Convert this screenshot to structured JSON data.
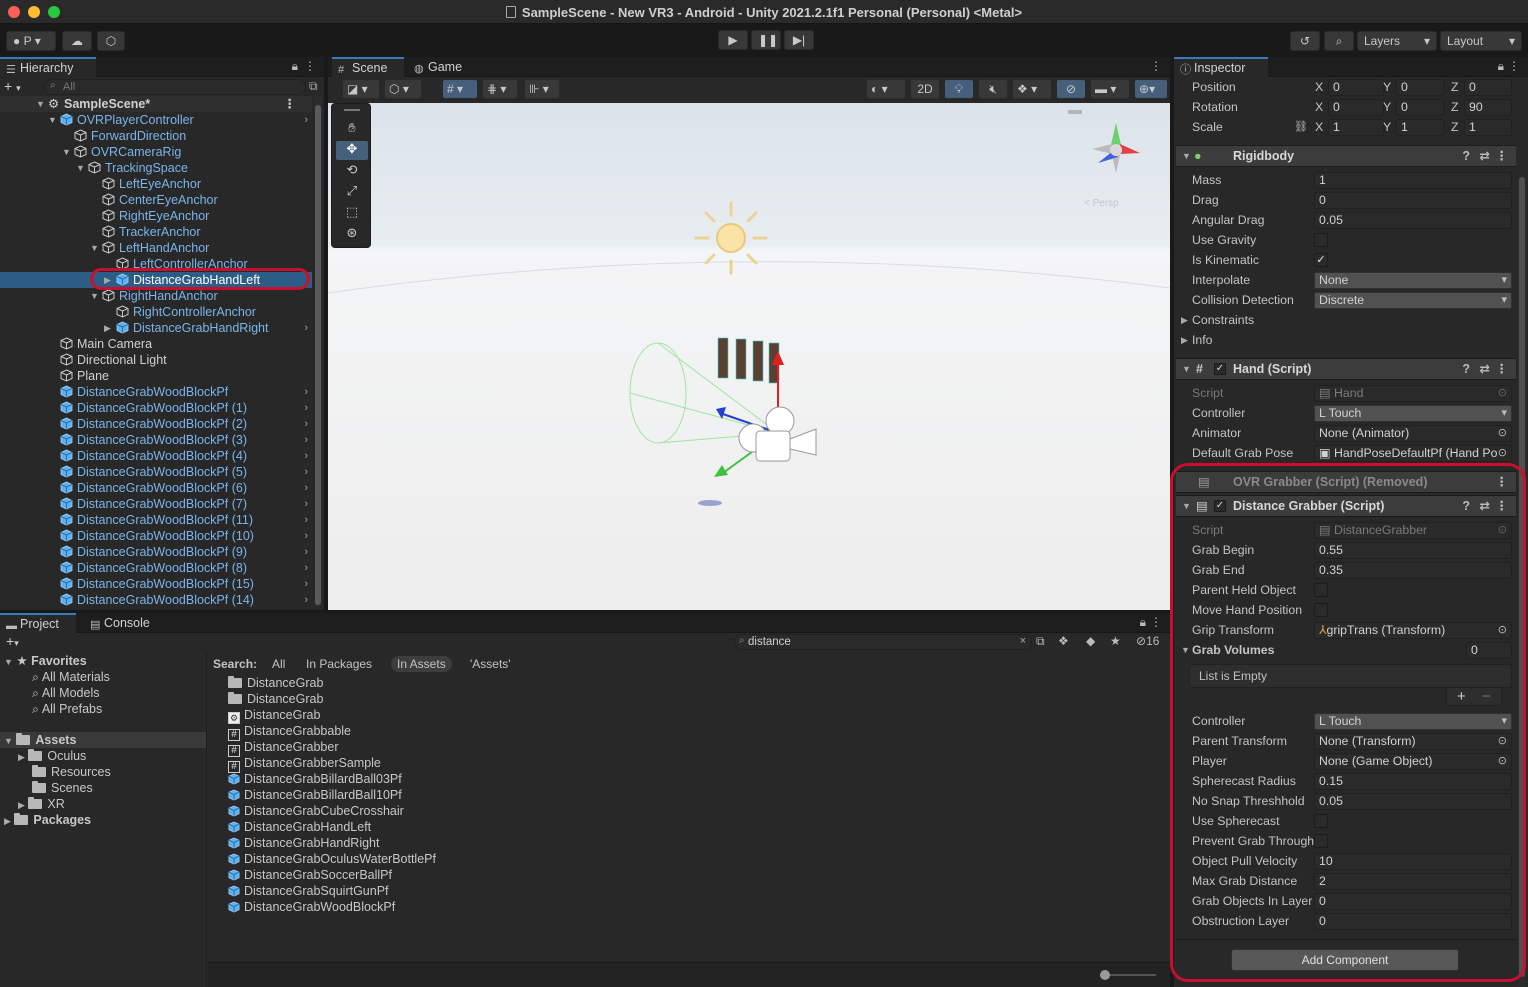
{
  "window": {
    "title": "SampleScene - New VR3 - Android - Unity 2021.2.1f1 Personal (Personal) <Metal>"
  },
  "toolbar": {
    "account": "P",
    "layers": "Layers",
    "layout": "Layout"
  },
  "hierarchy": {
    "tab": "Hierarchy",
    "search_placeholder": "All",
    "scene": "SampleScene*",
    "items": [
      {
        "label": "OVRPlayerController"
      },
      {
        "label": "ForwardDirection"
      },
      {
        "label": "OVRCameraRig"
      },
      {
        "label": "TrackingSpace"
      },
      {
        "label": "LeftEyeAnchor"
      },
      {
        "label": "CenterEyeAnchor"
      },
      {
        "label": "RightEyeAnchor"
      },
      {
        "label": "TrackerAnchor"
      },
      {
        "label": "LeftHandAnchor"
      },
      {
        "label": "LeftControllerAnchor"
      },
      {
        "label": "DistanceGrabHandLeft"
      },
      {
        "label": "RightHandAnchor"
      },
      {
        "label": "RightControllerAnchor"
      },
      {
        "label": "DistanceGrabHandRight"
      },
      {
        "label": "Main Camera"
      },
      {
        "label": "Directional Light"
      },
      {
        "label": "Plane"
      },
      {
        "label": "DistanceGrabWoodBlockPf"
      },
      {
        "label": "DistanceGrabWoodBlockPf (1)"
      },
      {
        "label": "DistanceGrabWoodBlockPf (2)"
      },
      {
        "label": "DistanceGrabWoodBlockPf (3)"
      },
      {
        "label": "DistanceGrabWoodBlockPf (4)"
      },
      {
        "label": "DistanceGrabWoodBlockPf (5)"
      },
      {
        "label": "DistanceGrabWoodBlockPf (6)"
      },
      {
        "label": "DistanceGrabWoodBlockPf (7)"
      },
      {
        "label": "DistanceGrabWoodBlockPf (11)"
      },
      {
        "label": "DistanceGrabWoodBlockPf (10)"
      },
      {
        "label": "DistanceGrabWoodBlockPf (9)"
      },
      {
        "label": "DistanceGrabWoodBlockPf (8)"
      },
      {
        "label": "DistanceGrabWoodBlockPf (15)"
      },
      {
        "label": "DistanceGrabWoodBlockPf (14)"
      }
    ]
  },
  "scene": {
    "tab_scene": "Scene",
    "tab_game": "Game",
    "mode_2d": "2D",
    "persp": "< Persp"
  },
  "inspector": {
    "tab": "Inspector",
    "transform": {
      "position_label": "Position",
      "position": [
        "0",
        "0",
        "0"
      ],
      "rotation_label": "Rotation",
      "rotation": [
        "0",
        "0",
        "90"
      ],
      "scale_label": "Scale",
      "scale": [
        "1",
        "1",
        "1"
      ]
    },
    "rigidbody": {
      "title": "Rigidbody",
      "mass_label": "Mass",
      "mass": "1",
      "drag_label": "Drag",
      "drag": "0",
      "angular_drag_label": "Angular Drag",
      "angular_drag": "0.05",
      "use_gravity_label": "Use Gravity",
      "use_gravity": false,
      "is_kinematic_label": "Is Kinematic",
      "is_kinematic": true,
      "interpolate_label": "Interpolate",
      "interpolate": "None",
      "collision_label": "Collision Detection",
      "collision": "Discrete",
      "constraints_label": "Constraints",
      "info_label": "Info"
    },
    "hand": {
      "title": "Hand (Script)",
      "script_label": "Script",
      "script": "Hand",
      "controller_label": "Controller",
      "controller": "L Touch",
      "animator_label": "Animator",
      "animator": "None (Animator)",
      "pose_label": "Default Grab Pose",
      "pose": "HandPoseDefaultPf (Hand Po"
    },
    "ovr_grabber": {
      "title": "OVR Grabber (Script) (Removed)"
    },
    "distance_grabber": {
      "title": "Distance Grabber (Script)",
      "script_label": "Script",
      "script": "DistanceGrabber",
      "grab_begin_label": "Grab Begin",
      "grab_begin": "0.55",
      "grab_end_label": "Grab End",
      "grab_end": "0.35",
      "parent_held_label": "Parent Held Object",
      "move_hand_label": "Move Hand Position",
      "grip_label": "Grip Transform",
      "grip": "gripTrans (Transform)",
      "volumes_label": "Grab Volumes",
      "volumes_count": "0",
      "list_empty": "List is Empty",
      "controller_label": "Controller",
      "controller": "L Touch",
      "parent_transform_label": "Parent Transform",
      "parent_transform": "None (Transform)",
      "player_label": "Player",
      "player": "None (Game Object)",
      "sphere_radius_label": "Spherecast Radius",
      "sphere_radius": "0.15",
      "no_snap_label": "No Snap Threshhold",
      "no_snap": "0.05",
      "use_sphere_label": "Use Spherecast",
      "prevent_label": "Prevent Grab Through",
      "pull_label": "Object Pull Velocity",
      "pull": "10",
      "max_dist_label": "Max Grab Distance",
      "max_dist": "2",
      "layer_label": "Grab Objects In Layer",
      "layer": "0",
      "obstruction_label": "Obstruction Layer",
      "obstruction": "0"
    },
    "add_component": "Add Component"
  },
  "project": {
    "tab_project": "Project",
    "tab_console": "Console",
    "search_value": "distance",
    "hidden_count": "16",
    "favorites": "Favorites",
    "fav_items": [
      "All Materials",
      "All Models",
      "All Prefabs"
    ],
    "assets": "Assets",
    "asset_items": [
      "Oculus",
      "Resources",
      "Scenes",
      "XR"
    ],
    "packages": "Packages",
    "search_label": "Search:",
    "scopes": [
      "All",
      "In Packages",
      "In Assets",
      "'Assets'"
    ],
    "results": [
      {
        "name": "DistanceGrab",
        "icon": "folder"
      },
      {
        "name": "DistanceGrab",
        "icon": "folder"
      },
      {
        "name": "DistanceGrab",
        "icon": "scene"
      },
      {
        "name": "DistanceGrabbable",
        "icon": "script"
      },
      {
        "name": "DistanceGrabber",
        "icon": "script"
      },
      {
        "name": "DistanceGrabberSample",
        "icon": "script"
      },
      {
        "name": "DistanceGrabBillardBall03Pf",
        "icon": "prefab"
      },
      {
        "name": "DistanceGrabBillardBall10Pf",
        "icon": "prefab"
      },
      {
        "name": "DistanceGrabCubeCrosshair",
        "icon": "prefab"
      },
      {
        "name": "DistanceGrabHandLeft",
        "icon": "prefab"
      },
      {
        "name": "DistanceGrabHandRight",
        "icon": "prefab"
      },
      {
        "name": "DistanceGrabOculusWaterBottlePf",
        "icon": "prefab"
      },
      {
        "name": "DistanceGrabSoccerBallPf",
        "icon": "prefab"
      },
      {
        "name": "DistanceGrabSquirtGunPf",
        "icon": "prefab"
      },
      {
        "name": "DistanceGrabWoodBlockPf",
        "icon": "prefab"
      }
    ]
  },
  "colors": {
    "accent": "#3a79bb",
    "highlight_ring": "#c8102e",
    "prefab_blue": "#7bb4ea"
  }
}
